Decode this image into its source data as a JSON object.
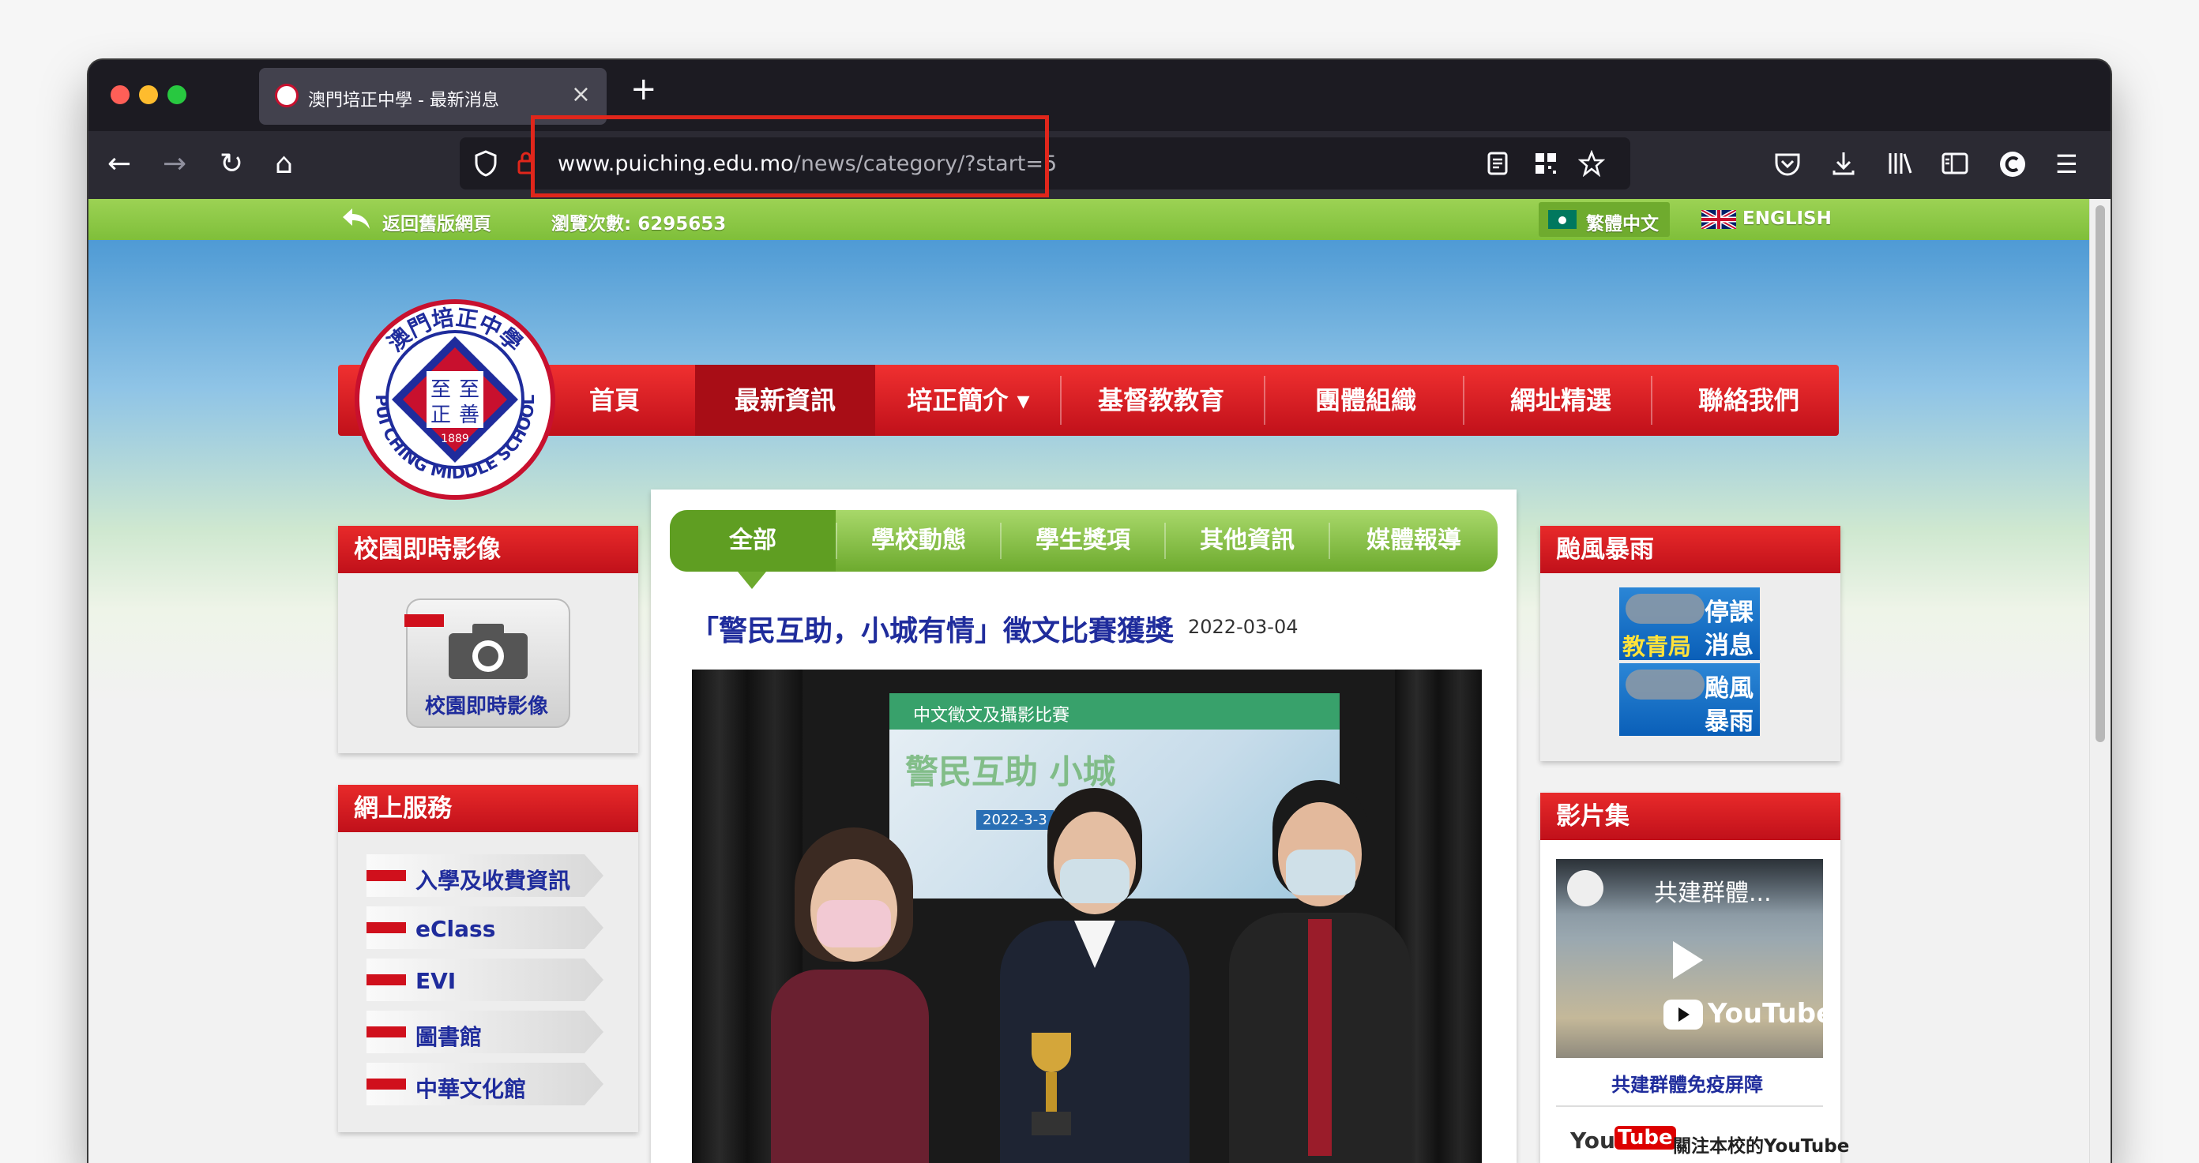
{
  "browser": {
    "tab_title": "澳門培正中學 - 最新消息",
    "close_glyph": "×",
    "new_tab_glyph": "+",
    "url_domain": "www.puiching.edu.mo",
    "url_path": "/news/category/?start=5",
    "nav_glyphs": {
      "back": "←",
      "forward": "→",
      "reload": "↻",
      "home": "⌂",
      "menu": "☰"
    }
  },
  "topbar": {
    "back_link": "返回舊版網頁",
    "visits": "瀏覽次數: 6295653",
    "lang_zh": "繁體中文",
    "lang_en": "ENGLISH"
  },
  "logo": {
    "top_text": "澳門培正中學",
    "bottom_text": "PUI CHING MIDDLE SCHOOL",
    "year": "1889",
    "motto": [
      "至",
      "至",
      "正",
      "善"
    ]
  },
  "mainnav": [
    "首頁",
    "最新資訊",
    "培正簡介 ▾",
    "基督教教育",
    "團體組織",
    "網址精選",
    "聯絡我們"
  ],
  "left": {
    "campus_title": "校園即時影像",
    "campus_button": "校園即時影像",
    "services_title": "網上服務",
    "services": [
      "入學及收費資訊",
      "eClass",
      "EVI",
      "圖書館",
      "中華文化館"
    ]
  },
  "center": {
    "tabs": [
      "全部",
      "學校動態",
      "學生獎項",
      "其他資訊",
      "媒體報導"
    ],
    "headline": "「警民互助，小城有情」徵文比賽獲獎",
    "date": "2022-03-04",
    "photo_banner": "中文徵文及攝影比賽",
    "photo_slogan": "警民互助 小城",
    "photo_date": "2022-3-3"
  },
  "right": {
    "typhoon_title": "颱風暴雨",
    "typhoon_links": [
      "教青局",
      "停課",
      "消息",
      "颱風",
      "暴雨"
    ],
    "video_title": "影片集",
    "video_caption": "共建群體...",
    "video_brand": "YouTube",
    "video_link": "共建群體免疫屏障",
    "youtube_brand": "You",
    "youtube_tube": "Tube",
    "youtube_follow": "關注本校的YouTube"
  },
  "colors": {
    "accent_red": "#c8102e",
    "green": "#7fbf3a",
    "navy": "#1f2c9c",
    "highlight": "#e0261b"
  }
}
